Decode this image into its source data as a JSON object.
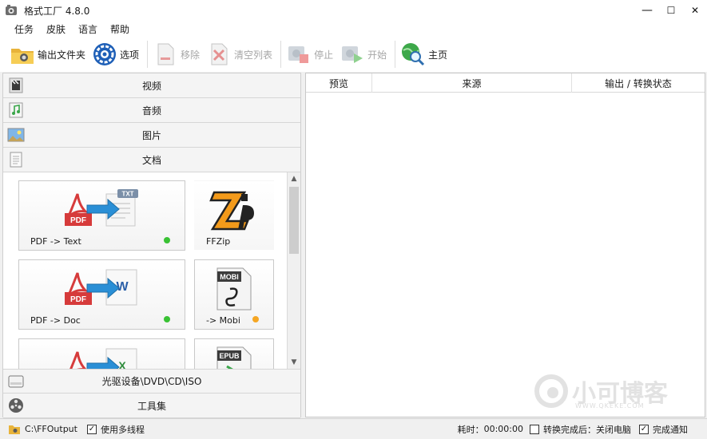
{
  "window": {
    "title": "格式工厂 4.8.0",
    "minimize": "—",
    "maximize": "☐",
    "close": "✕"
  },
  "menu": [
    "任务",
    "皮肤",
    "语言",
    "帮助"
  ],
  "toolbar": {
    "output_folder": "输出文件夹",
    "options": "选项",
    "remove": "移除",
    "clear_list": "清空列表",
    "stop": "停止",
    "start": "开始",
    "home": "主页"
  },
  "categories": {
    "video": "视频",
    "audio": "音频",
    "image": "图片",
    "document": "文档",
    "optical": "光驱设备\\DVD\\CD\\ISO",
    "tools": "工具集"
  },
  "doc_items": [
    {
      "label": "PDF -> Text",
      "status_color": "#39c234"
    },
    {
      "label": "FFZip",
      "status_color": ""
    },
    {
      "label": "PDF -> Doc",
      "status_color": "#39c234"
    },
    {
      "label": "-> Mobi",
      "status_color": "#f5a623"
    }
  ],
  "columns": {
    "preview": "预览",
    "source": "来源",
    "status": "输出 / 转换状态"
  },
  "status": {
    "output_path": "C:\\FFOutput",
    "multithread": "使用多线程",
    "elapsed_label": "耗时：",
    "elapsed": "00:00:00",
    "after_convert": "转换完成后：关闭电脑",
    "notify": "完成通知"
  },
  "watermark": {
    "text": "小可博客",
    "sub": "WWW.QKEKE.COM"
  }
}
